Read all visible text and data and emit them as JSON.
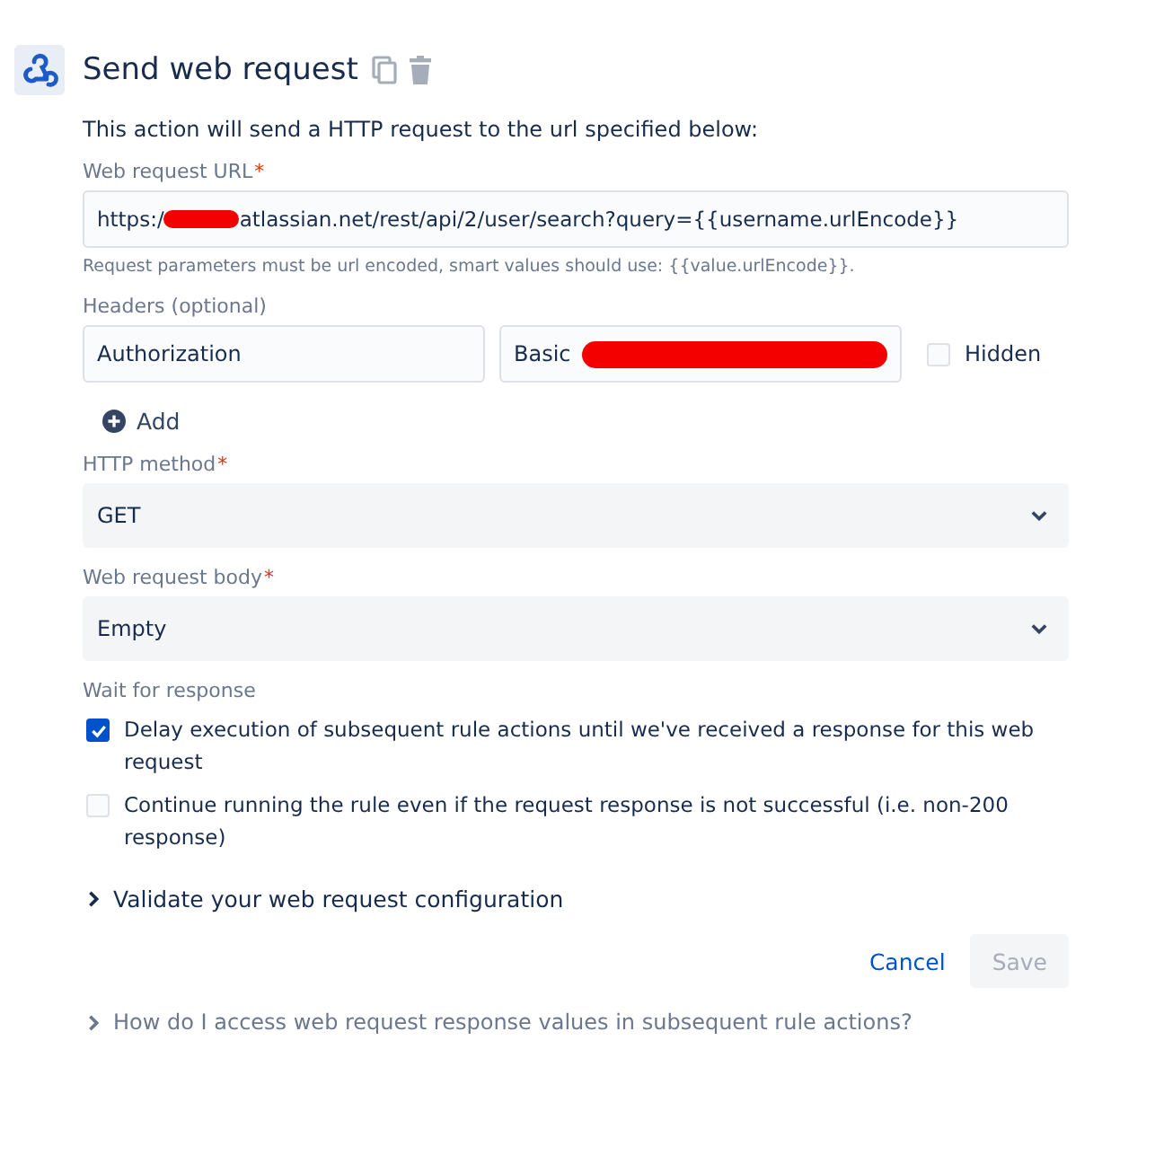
{
  "title": "Send web request",
  "description": "This action will send a HTTP request to the url specified below:",
  "url_field": {
    "label": "Web request URL",
    "required_mark": "*",
    "value_before": "https:/",
    "redacted": true,
    "value_after": "atlassian.net/rest/api/2/user/search?query={{username.urlEncode}}",
    "help": "Request parameters must be url encoded, smart values should use: {{value.urlEncode}}."
  },
  "headers": {
    "label": "Headers (optional)",
    "rows": [
      {
        "name": "Authorization",
        "value": "Basic",
        "redacted": true,
        "hidden_label": "Hidden",
        "hidden": false
      }
    ],
    "add_label": "Add"
  },
  "selects": [
    {
      "label": "HTTP method",
      "required_mark": "*",
      "value": "GET"
    },
    {
      "label": "Web request body",
      "required_mark": "*",
      "value": "Empty"
    }
  ],
  "wait": {
    "label": "Wait for response",
    "options": [
      {
        "text": "Delay execution of subsequent rule actions until we've received a response for this web request",
        "checked": true
      },
      {
        "text": "Continue running the rule even if the request response is not successful (i.e. non-200 response)",
        "checked": false
      }
    ]
  },
  "validate": {
    "label": "Validate your web request configuration",
    "expanded": false
  },
  "buttons": [
    {
      "label": "Cancel",
      "kind": "link",
      "disabled": false
    },
    {
      "label": "Save",
      "kind": "primary",
      "disabled": true
    }
  ],
  "help_link": {
    "label": "How do I access web request response values in subsequent rule actions?",
    "expanded": false
  }
}
